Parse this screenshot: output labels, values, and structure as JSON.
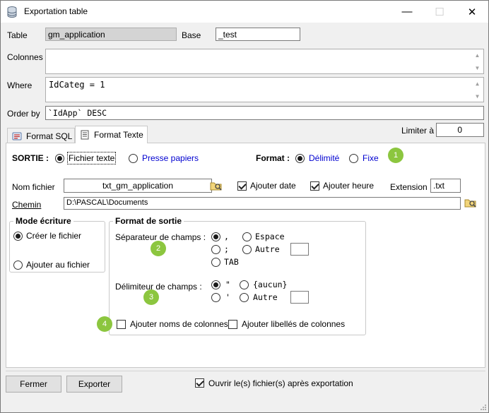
{
  "window": {
    "title": "Exportation table",
    "minimize_glyph": "—",
    "maximize_glyph": "☐",
    "close_glyph": "✕"
  },
  "fields": {
    "table_label": "Table",
    "table_value": "gm_application",
    "base_label": "Base",
    "base_value": "_test",
    "colonnes_label": "Colonnes",
    "colonnes_value": "",
    "where_label": "Where",
    "where_value": "IdCateg = 1",
    "orderby_label": "Order by",
    "orderby_value": "`IdApp` DESC",
    "limiter_label": "Limiter à",
    "limiter_value": "0"
  },
  "tabs": [
    {
      "label": "Format SQL"
    },
    {
      "label": "Format Texte"
    }
  ],
  "sortie": {
    "label": "SORTIE :",
    "options": [
      "Fichier texte",
      "Presse papiers"
    ],
    "selected": "Fichier texte"
  },
  "format": {
    "label": "Format :",
    "options": [
      "Délimité",
      "Fixe"
    ],
    "selected": "Délimité"
  },
  "file": {
    "nom_label": "Nom fichier",
    "nom_value": "txt_gm_application",
    "ajouter_date_label": "Ajouter date",
    "ajouter_date": true,
    "ajouter_heure_label": "Ajouter heure",
    "ajouter_heure": true,
    "extension_label": "Extension",
    "extension_value": ".txt",
    "chemin_label": "Chemin",
    "chemin_value": "D:\\PASCAL\\Documents"
  },
  "mode_ecriture": {
    "title": "Mode écriture",
    "options": [
      "Créer le fichier",
      "Ajouter au fichier"
    ],
    "selected": "Créer le fichier"
  },
  "format_sortie": {
    "title": "Format de sortie",
    "separateur_label": "Séparateur de champs :",
    "separateur_options": [
      ",",
      "Espace",
      ";",
      "Autre",
      "TAB"
    ],
    "separateur_selected": ",",
    "separateur_autre_value": "",
    "delimiteur_label": "Délimiteur de champs :",
    "delimiteur_options": [
      "\"",
      "{aucun}",
      "'",
      "Autre"
    ],
    "delimiteur_selected": "\"",
    "delimiteur_autre_value": "",
    "ajouter_noms_label": "Ajouter noms de colonnes",
    "ajouter_noms": false,
    "ajouter_libelles_label": "Ajouter libellés de colonnes",
    "ajouter_libelles": false
  },
  "badges": [
    "1",
    "2",
    "3",
    "4"
  ],
  "footer": {
    "fermer_label": "Fermer",
    "exporter_label": "Exporter",
    "ouvrir_label": "Ouvrir le(s) fichier(s) après exportation",
    "ouvrir": true
  },
  "colors": {
    "badge": "#8cc63f",
    "link_blue": "#0000d0"
  }
}
